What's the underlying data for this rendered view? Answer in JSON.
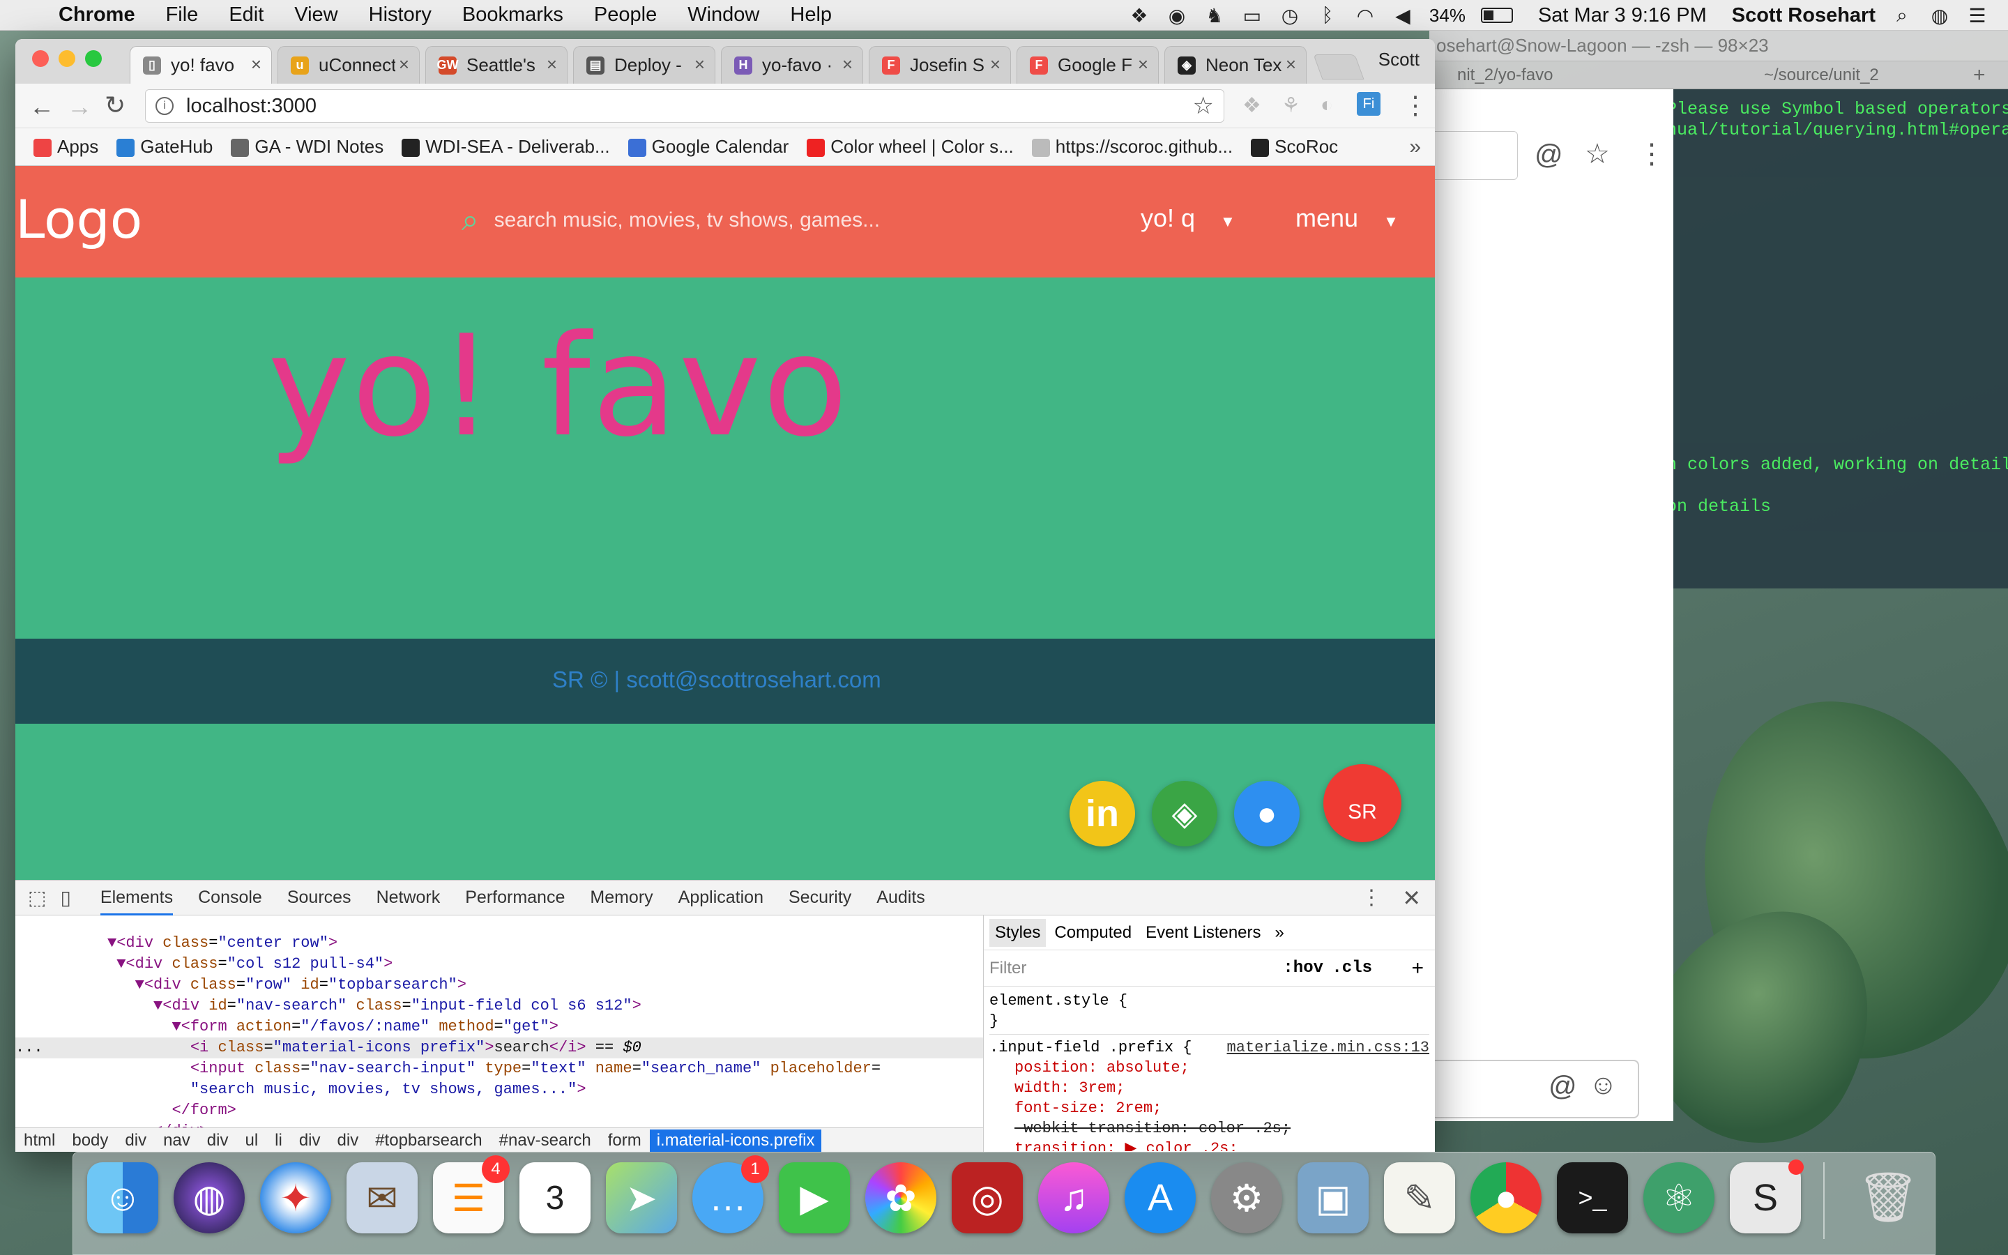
{
  "menubar": {
    "app": "Chrome",
    "items": [
      "File",
      "Edit",
      "View",
      "History",
      "Bookmarks",
      "People",
      "Window",
      "Help"
    ],
    "battery": "34%",
    "datetime": "Sat Mar 3  9:16 PM",
    "user": "Scott Rosehart"
  },
  "terminal": {
    "title": "osehart@Snow-Lagoon — -zsh — 98×23",
    "tab_left": "nit_2/yo-favo",
    "tab_right": "~/source/unit_2",
    "lines": [
      "Please use Symbol based operators",
      "nual/tutorial/querying.html#operat",
      "n colors added, working on details",
      "on details"
    ]
  },
  "browser": {
    "profile": "Scott",
    "tabs": [
      {
        "label": "yo! favo",
        "icon": "page-icon",
        "color": "#888888",
        "glyph": "▯"
      },
      {
        "label": "uConnect",
        "icon": "uconnect-icon",
        "color": "#e8a31a",
        "glyph": "u"
      },
      {
        "label": "Seattle's",
        "icon": "gw-icon",
        "color": "#d44a2a",
        "glyph": "GW"
      },
      {
        "label": "Deploy -",
        "icon": "book-icon",
        "color": "#555555",
        "glyph": "▤"
      },
      {
        "label": "yo-favo ·",
        "icon": "heroku-icon",
        "color": "#7b5bb6",
        "glyph": "H"
      },
      {
        "label": "Josefin S",
        "icon": "google-fonts-icon",
        "color": "#ef4c47",
        "glyph": "F"
      },
      {
        "label": "Google F",
        "icon": "google-fonts-icon",
        "color": "#ef4c47",
        "glyph": "F"
      },
      {
        "label": "Neon Tex",
        "icon": "codepen-icon",
        "color": "#222222",
        "glyph": "◈"
      }
    ],
    "url": "localhost:3000",
    "bookmarks": [
      {
        "label": "Apps",
        "color": "#e44"
      },
      {
        "label": "GateHub",
        "color": "#2a7fd4"
      },
      {
        "label": "GA - WDI Notes",
        "color": "#666"
      },
      {
        "label": "WDI-SEA - Deliverab...",
        "color": "#222"
      },
      {
        "label": "Google Calendar",
        "color": "#3b6fd6"
      },
      {
        "label": "Color wheel | Color s...",
        "color": "#e22"
      },
      {
        "label": "https://scoroc.github...",
        "color": "#bbb"
      },
      {
        "label": "ScoRoc",
        "color": "#222"
      }
    ]
  },
  "page": {
    "logo": "Logo",
    "search_placeholder": "search music, movies, tv shows, games...",
    "nav_yoq": "yo! q",
    "nav_menu": "menu",
    "brand": "yo! favo",
    "footer": "SR © | scott@scottrosehart.com",
    "fab_sr": "SR",
    "colors": {
      "nav": "#ee6352",
      "body": "#41b685",
      "footer": "#1f4d55",
      "brand": "#e4398a"
    }
  },
  "devtools": {
    "tabs": [
      "Elements",
      "Console",
      "Sources",
      "Network",
      "Performance",
      "Memory",
      "Application",
      "Security",
      "Audits"
    ],
    "breadcrumbs": [
      "html",
      "body",
      "div",
      "nav",
      "div",
      "ul",
      "li",
      "div",
      "div",
      "#topbarsearch",
      "#nav-search",
      "form",
      "i.material-icons.prefix"
    ],
    "styles_tabs": [
      "Styles",
      "Computed",
      "Event Listeners"
    ],
    "filter": "Filter",
    "hov": ":hov",
    "cls": ".cls",
    "element_style": "element.style {",
    "close_brace": "}",
    "rule_selector": ".input-field .prefix {",
    "rule_source": "materialize.min.css:13",
    "props": [
      "position: absolute;",
      "width: 3rem;",
      "font-size: 2rem;",
      "-webkit-transition: color .2s;",
      "transition: ▶ color .2s;"
    ]
  }
}
